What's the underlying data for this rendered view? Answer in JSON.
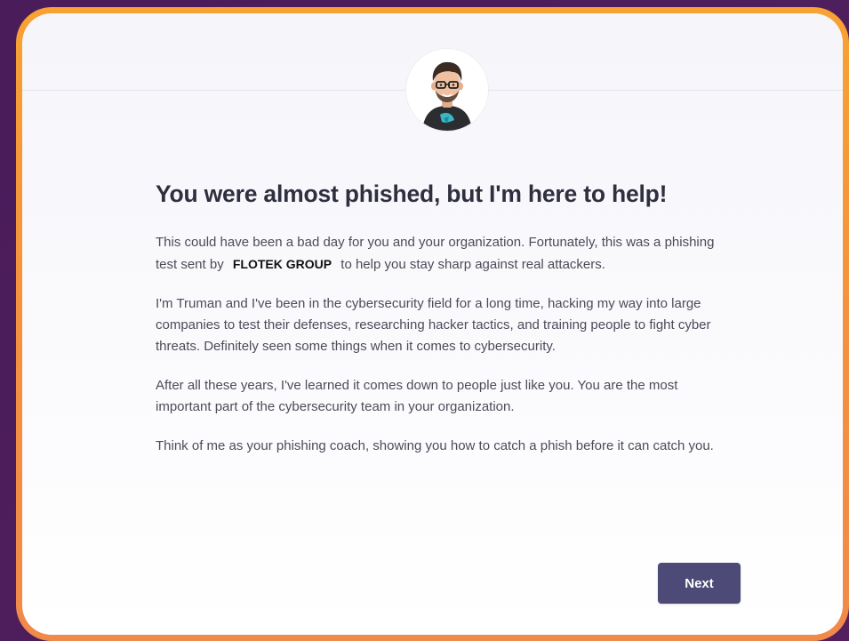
{
  "header": {
    "avatar_icon": "cartoon-avatar-man-with-glasses"
  },
  "main": {
    "headline": "You were almost phished, but I'm here to help!",
    "paragraph1": {
      "before": "This could have been a bad day for you and your organization. Fortunately, this was a phishing test sent by ",
      "brand": "FLOTEK GROUP",
      "after": " to help you stay sharp against real attackers."
    },
    "paragraph2": "I'm Truman and I've been in the cybersecurity field for a long time, hacking my way into large companies to test their defenses, researching hacker tactics, and training people to fight cyber threats. Definitely seen some things when it comes to cybersecurity.",
    "paragraph3": "After all these years, I've learned it comes down to people just like you. You are the most important part of the cybersecurity team in your organization.",
    "paragraph4": "Think of me as your phishing coach, showing you how to catch a phish before it can catch you."
  },
  "footer": {
    "next_label": "Next"
  },
  "colors": {
    "background": "#4b1f57",
    "frame": "#f5913f",
    "button": "#4e4a78",
    "headline": "#2f2f3f"
  }
}
